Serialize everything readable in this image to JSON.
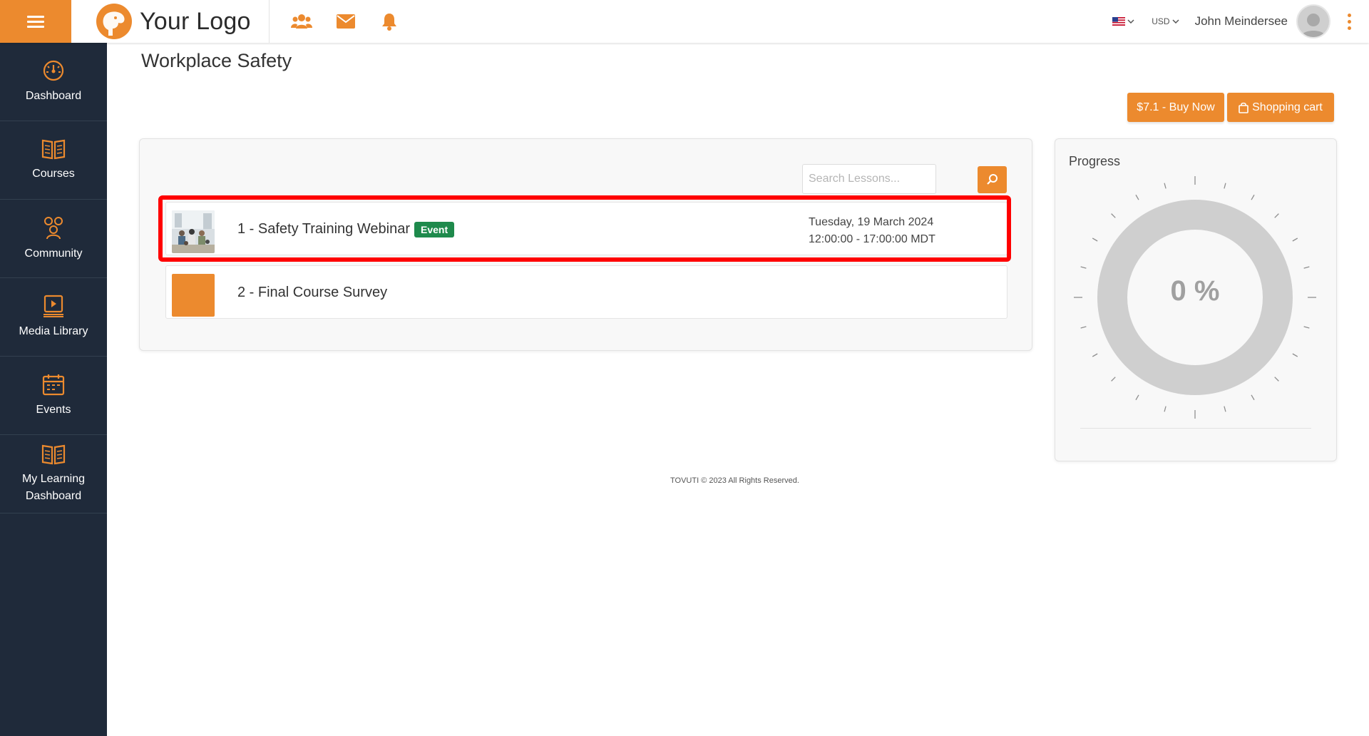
{
  "header": {
    "logo_text": "Your Logo",
    "icons": [
      "users-icon",
      "envelope-icon",
      "bell-icon"
    ],
    "currency": "USD",
    "user_name": "John Meindersee"
  },
  "sidebar": {
    "items": [
      {
        "label": "Dashboard",
        "icon": "speedometer-icon"
      },
      {
        "label": "Courses",
        "icon": "book-icon"
      },
      {
        "label": "Community",
        "icon": "community-icon"
      },
      {
        "label": "Media Library",
        "icon": "media-library-icon"
      },
      {
        "label": "Events",
        "icon": "calendar-icon"
      },
      {
        "label": "My Learning Dashboard",
        "icon": "open-book-icon"
      }
    ]
  },
  "page": {
    "title": "Workplace Safety",
    "buy_now_label": "$7.1 - Buy Now",
    "cart_label": "Shopping cart"
  },
  "lessons": {
    "search_placeholder": "Search Lessons...",
    "items": [
      {
        "title": "1 - Safety Training Webinar",
        "badge": "Event",
        "date": "Tuesday, 19 March 2024",
        "time": "12:00:00 - 17:00:00 MDT"
      },
      {
        "title": "2 - Final Course Survey"
      }
    ]
  },
  "progress": {
    "title": "Progress",
    "value_label": "0 %",
    "percent": 0
  },
  "footer": {
    "text": "TOVUTI © 2023 All Rights Reserved."
  },
  "colors": {
    "accent": "#ec8a2e",
    "sidebar_bg": "#1f2a3a",
    "badge_green": "#1e8a4c",
    "highlight_red": "#ff0000"
  }
}
